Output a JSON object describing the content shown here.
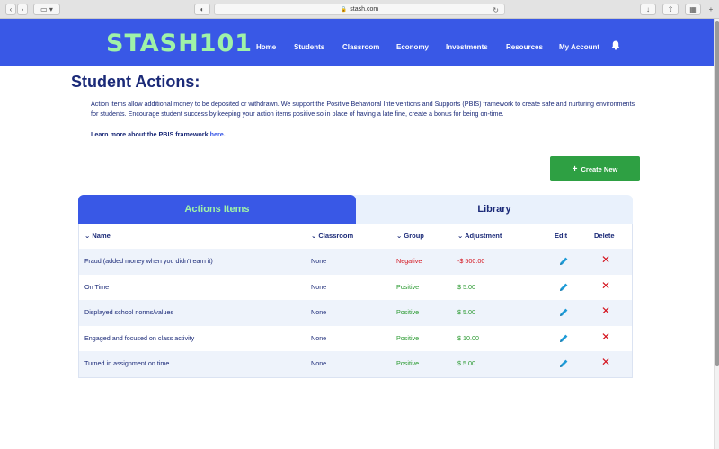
{
  "browser": {
    "url": "stash.com"
  },
  "nav": {
    "logo": "STASH101",
    "items": [
      "Home",
      "Students",
      "Classroom",
      "Economy",
      "Investments",
      "Resources",
      "My Account"
    ]
  },
  "page": {
    "title": "Student Actions:",
    "description": "Action items allow additional money to be deposited or withdrawn. We support the Positive Behavioral Interventions and Supports (PBIS) framework to create safe and nurturing environments for students. Encourage student success by keeping your action items positive so in place of having a late fine, create a bonus for being on-time.",
    "learn_more_prefix": "Learn more about the PBIS framework ",
    "learn_more_link": "here",
    "learn_more_suffix": ".",
    "create_button": "Create New"
  },
  "tabs": {
    "active": "Actions Items",
    "library": "Library"
  },
  "table": {
    "columns": [
      "Name",
      "Classroom",
      "Group",
      "Adjustment",
      "Edit",
      "Delete"
    ],
    "rows": [
      {
        "name": "Fraud (added money when you didn't earn it)",
        "classroom": "None",
        "group": "Negative",
        "adjustment": "-$ 500.00"
      },
      {
        "name": "On Time",
        "classroom": "None",
        "group": "Positive",
        "adjustment": "$ 5.00"
      },
      {
        "name": "Displayed school norms/values",
        "classroom": "None",
        "group": "Positive",
        "adjustment": "$ 5.00"
      },
      {
        "name": "Engaged and focused on class activity",
        "classroom": "None",
        "group": "Positive",
        "adjustment": "$ 10.00"
      },
      {
        "name": "Turned in assignment on time",
        "classroom": "None",
        "group": "Positive",
        "adjustment": "$ 5.00"
      }
    ]
  },
  "colors": {
    "brand_blue": "#3958e6",
    "logo_green": "#9ff2a8",
    "navy_text": "#1b2a78",
    "negative": "#d4141e",
    "positive": "#2a9a30",
    "create_green": "#2ea043"
  }
}
